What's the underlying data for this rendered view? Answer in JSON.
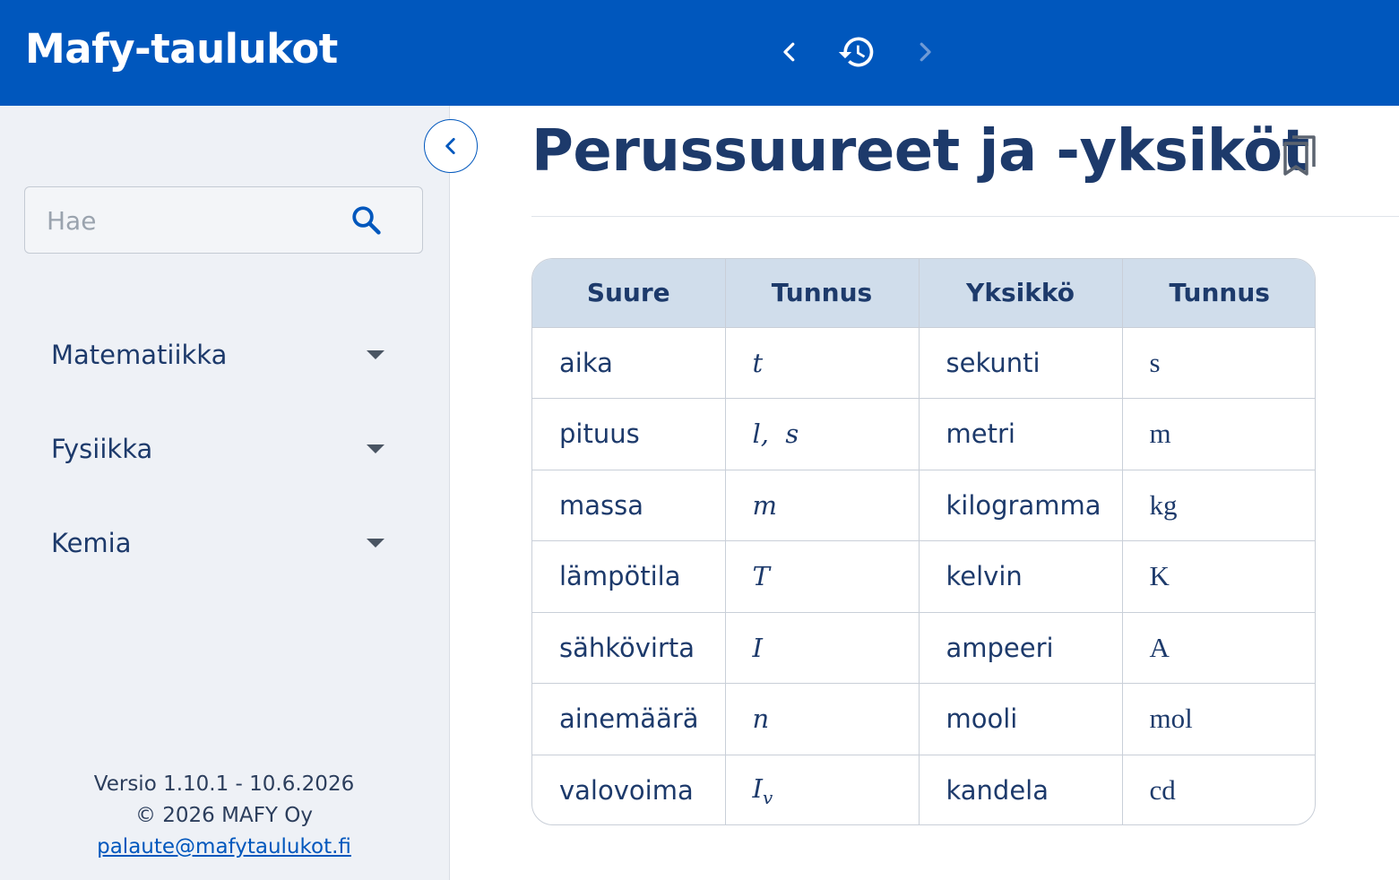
{
  "header": {
    "app_title": "Mafy-taulukot",
    "back_icon": "chevron-left-icon",
    "history_icon": "history-icon",
    "forward_icon": "chevron-right-icon"
  },
  "sidebar": {
    "search": {
      "placeholder": "Hae",
      "value": ""
    },
    "menu": [
      {
        "label": "Matematiikka"
      },
      {
        "label": "Fysiikka"
      },
      {
        "label": "Kemia"
      }
    ],
    "footer": {
      "version": "Versio 1.10.1 - 10.6.2026",
      "copyright": "© 2026 MAFY Oy",
      "email": "palaute@mafytaulukot.fi"
    }
  },
  "main": {
    "title": "Perussuureet ja -yksiköt",
    "table": {
      "headers": [
        "Suure",
        "Tunnus",
        "Yksikkö",
        "Tunnus"
      ],
      "rows": [
        {
          "suure": "aika",
          "tunnus": "t",
          "sub": "",
          "yksikko": "sekunti",
          "yksikko_tunnus": "s"
        },
        {
          "suure": "pituus",
          "tunnus": "l,  s",
          "sub": "",
          "yksikko": "metri",
          "yksikko_tunnus": "m"
        },
        {
          "suure": "massa",
          "tunnus": "m",
          "sub": "",
          "yksikko": "kilogramma",
          "yksikko_tunnus": "kg"
        },
        {
          "suure": "lämpötila",
          "tunnus": "T",
          "sub": "",
          "yksikko": "kelvin",
          "yksikko_tunnus": "K"
        },
        {
          "suure": "sähkövirta",
          "tunnus": "I",
          "sub": "",
          "yksikko": "ampeeri",
          "yksikko_tunnus": "A"
        },
        {
          "suure": "ainemäärä",
          "tunnus": "n",
          "sub": "",
          "yksikko": "mooli",
          "yksikko_tunnus": "mol"
        },
        {
          "suure": "valovoima",
          "tunnus": "I",
          "sub": "v",
          "yksikko": "kandela",
          "yksikko_tunnus": "cd"
        }
      ]
    }
  },
  "colors": {
    "header_bg": "#0057bd",
    "sidebar_bg": "#eef1f6",
    "text_dark": "#1d3a6b",
    "table_header_bg": "#d0ddeb"
  }
}
